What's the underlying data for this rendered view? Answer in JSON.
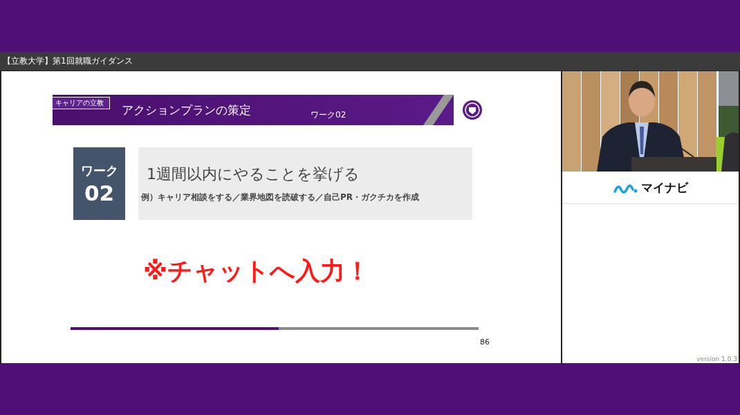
{
  "window": {
    "title": "【立教大学】第1回就職ガイダンス"
  },
  "slide": {
    "tag": "キャリアの立教",
    "title": "アクションプランの策定",
    "subtitle": "ワーク02",
    "work_label": "ワーク",
    "work_number": "02",
    "heading": "1週間以内にやることを挙げる",
    "example": "例）キャリア相談をする／業界地図を読破する／自己PR・ガクチカを作成",
    "callout": "※チャットへ入力！",
    "progress": {
      "level": 0.51
    },
    "page_number": "86"
  },
  "side_panel": {
    "sponsor": "マイナビ",
    "version": "version 1.0.3"
  }
}
